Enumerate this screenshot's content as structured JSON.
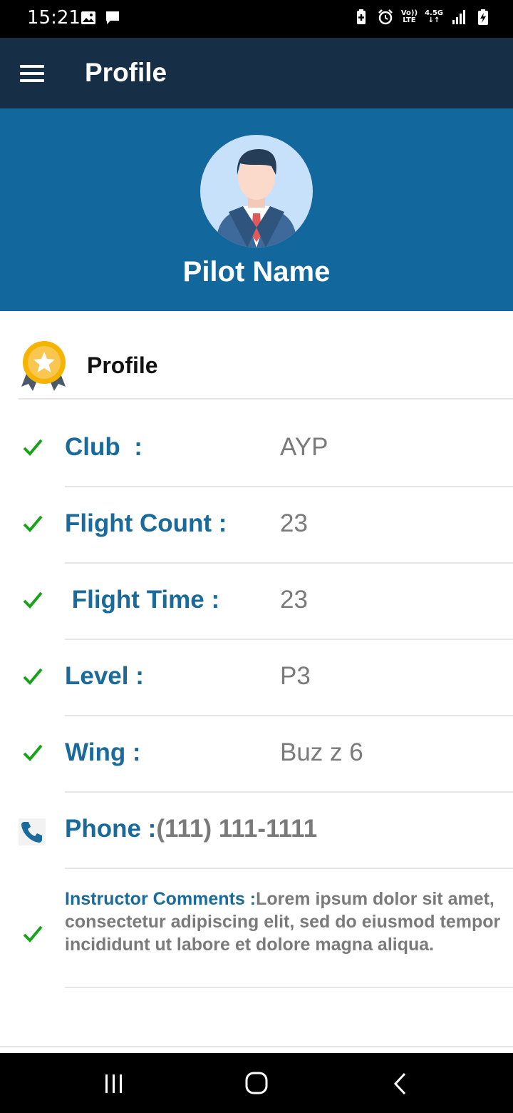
{
  "status_bar": {
    "time": "15:21",
    "left_icons": [
      "image-icon",
      "message-icon"
    ],
    "right_icons": [
      "battery-saver-icon",
      "alarm-icon",
      "volte-icon",
      "data-icon",
      "signal-icon",
      "battery-charging-icon"
    ],
    "volte_label_top": "Vo))",
    "volte_label_bottom": "LTE",
    "data_label": "4.5G"
  },
  "app_bar": {
    "title": "Profile",
    "menu_icon": "hamburger-menu-icon"
  },
  "header": {
    "pilot_name": "Pilot Name",
    "avatar_icon": "businessman-avatar-icon",
    "color": "#12679c"
  },
  "section": {
    "title": "Profile",
    "icon": "award-medal-icon"
  },
  "rows": [
    {
      "label": "Club  :",
      "value": "AYP",
      "icon": "check-icon"
    },
    {
      "label": "Flight Count :",
      "value": "23",
      "icon": "check-icon"
    },
    {
      "label": " Flight Time :",
      "value": "23",
      "icon": "check-icon"
    },
    {
      "label": "Level :",
      "value": "P3",
      "icon": "check-icon"
    },
    {
      "label": "Wing :",
      "value": "Buz z 6",
      "icon": "check-icon"
    }
  ],
  "phone": {
    "label": "Phone :",
    "value": "(111) 111-1111",
    "icon": "phone-icon"
  },
  "comments": {
    "label": "Instructor Comments :",
    "text": "Lorem ipsum dolor sit amet, consectetur adipiscing elit, sed do eiusmod tempor incididunt ut labore et dolore magna aliqua.",
    "icon": "check-icon"
  },
  "colors": {
    "app_bar": "#172e47",
    "label_blue": "#1a6a9b",
    "value_gray": "#7a7a7a",
    "check_green": "#19a31a"
  },
  "nav_bar": {
    "buttons": [
      "recent-apps-icon",
      "home-icon",
      "back-icon"
    ]
  }
}
